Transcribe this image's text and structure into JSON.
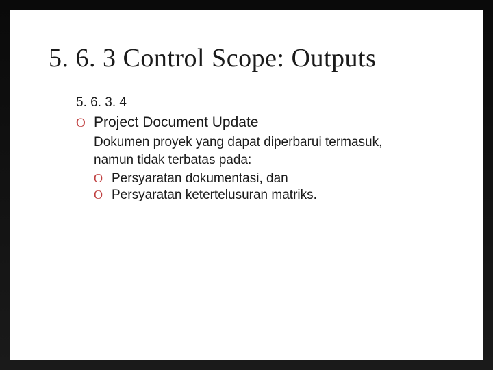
{
  "title": "5. 6. 3 Control Scope: Outputs",
  "section_number": "5. 6. 3. 4",
  "bullet_marker": "O",
  "main_bullet": "Project Document Update",
  "body_text": "Dokumen proyek yang dapat diperbarui termasuk, namun tidak terbatas pada:",
  "sub_bullets": {
    "0": "Persyaratan dokumentasi, dan",
    "1": "Persyaratan ketertelusuran matriks."
  }
}
